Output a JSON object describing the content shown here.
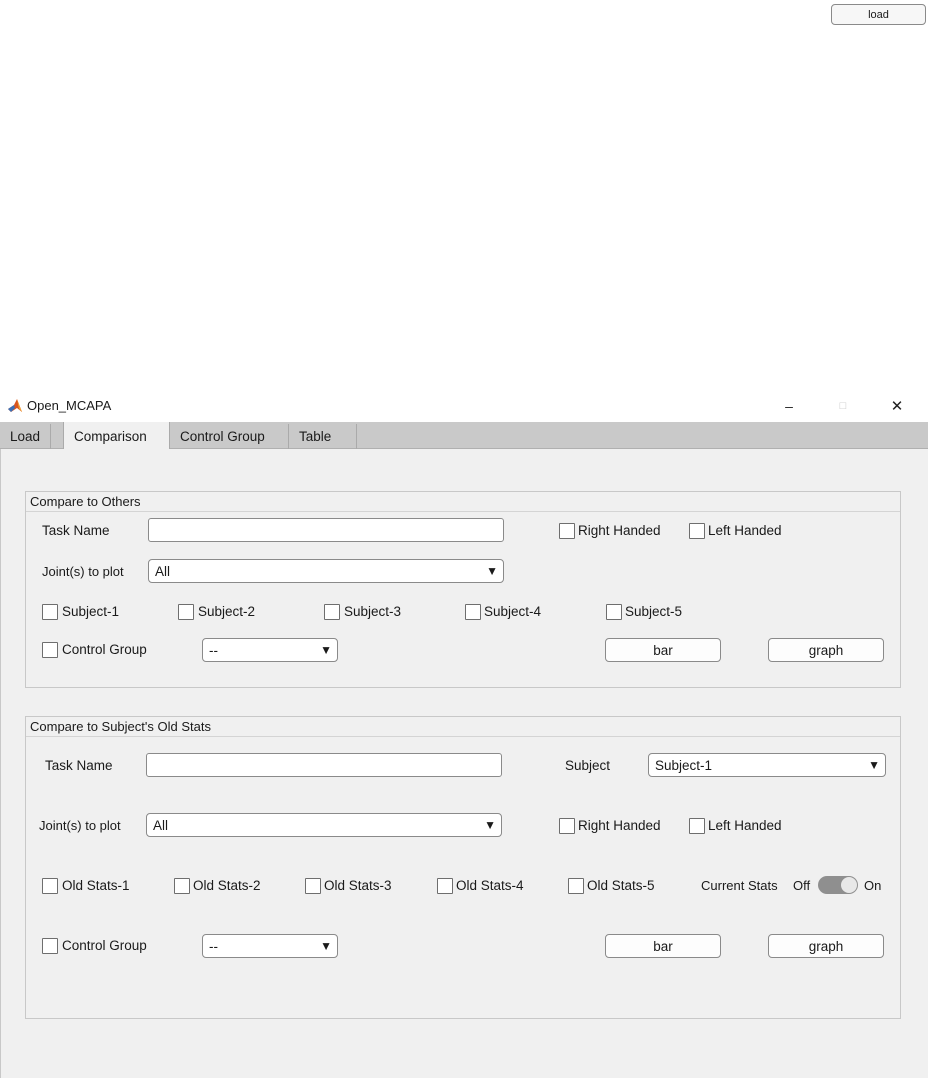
{
  "top_load_label": "load",
  "window": {
    "title": "Open_MCAPA",
    "minimize": "–",
    "maximize": "□",
    "close": "✕",
    "icon": "matlab-icon"
  },
  "tabs": [
    "Load",
    "Comparison",
    "Control Group",
    "Table"
  ],
  "panel1": {
    "title": "Compare to Others",
    "task_name_label": "Task Name",
    "task_name_value": "",
    "right_handed": "Right Handed",
    "left_handed": "Left Handed",
    "joints_label": "Joint(s) to plot",
    "joints_value": "All",
    "subjects": [
      "Subject-1",
      "Subject-2",
      "Subject-3",
      "Subject-4",
      "Subject-5"
    ],
    "control_group_label": "Control Group",
    "control_group_value": "--",
    "bar_label": "bar",
    "graph_label": "graph"
  },
  "panel2": {
    "title": "Compare to Subject's Old Stats",
    "task_name_label": "Task Name",
    "task_name_value": "",
    "subject_label": "Subject",
    "subject_value": "Subject-1",
    "joints_label": "Joint(s) to plot",
    "joints_value": "All",
    "right_handed": "Right Handed",
    "left_handed": "Left Handed",
    "old_stats": [
      "Old Stats-1",
      "Old Stats-2",
      "Old Stats-3",
      "Old Stats-4",
      "Old Stats-5"
    ],
    "current_stats_label": "Current Stats",
    "switch_off": "Off",
    "switch_on": "On",
    "switch_state": "On",
    "control_group_label": "Control Group",
    "control_group_value": "--",
    "bar_label": "bar",
    "graph_label": "graph"
  }
}
